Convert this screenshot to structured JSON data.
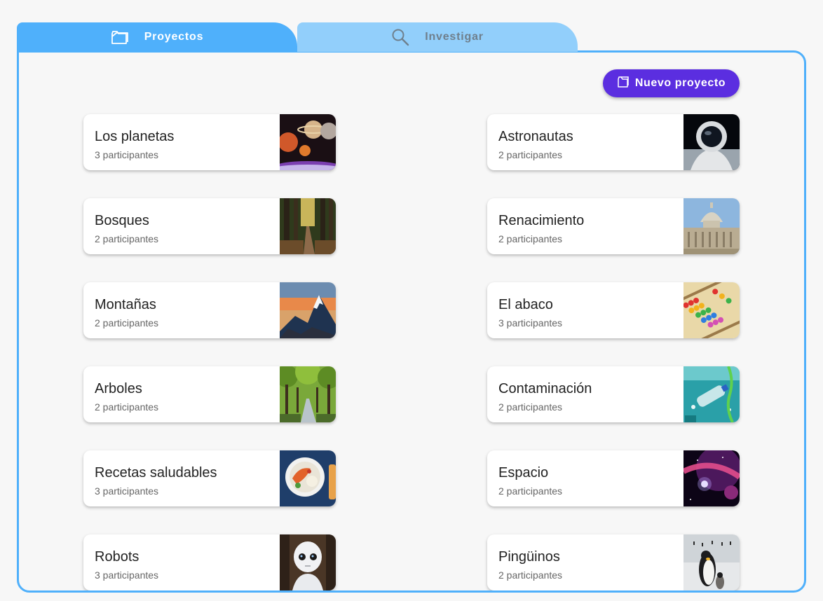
{
  "tabs": {
    "projects_label": "Proyectos",
    "research_label": "Investigar",
    "projects_icon": "folder-icon",
    "research_icon": "search-icon"
  },
  "toolbar": {
    "new_project_label": "Nuevo proyecto",
    "new_project_icon": "folder-icon"
  },
  "colors": {
    "accent": "#4fb0fb",
    "tab_inactive": "#92cffb",
    "button": "#5b2ee0"
  },
  "projects": [
    {
      "title": "Los planetas",
      "participants": "3 participantes",
      "image": "planets-image"
    },
    {
      "title": "Astronautas",
      "participants": "2 participantes",
      "image": "astronaut-image"
    },
    {
      "title": "Bosques",
      "participants": "2 participantes",
      "image": "forest-image"
    },
    {
      "title": "Renacimiento",
      "participants": "2 participantes",
      "image": "basilica-image"
    },
    {
      "title": "Montañas",
      "participants": "2 participantes",
      "image": "mountains-image"
    },
    {
      "title": "El abaco",
      "participants": "3 participantes",
      "image": "abacus-image"
    },
    {
      "title": "Arboles",
      "participants": "2 participantes",
      "image": "trees-image"
    },
    {
      "title": "Contaminación",
      "participants": "2 participantes",
      "image": "pollution-image"
    },
    {
      "title": "Recetas saludables",
      "participants": "3 participantes",
      "image": "healthy-food-image"
    },
    {
      "title": "Espacio",
      "participants": "2 participantes",
      "image": "space-image"
    },
    {
      "title": "Robots",
      "participants": "3 participantes",
      "image": "robot-image"
    },
    {
      "title": "Pingüinos",
      "participants": "2 participantes",
      "image": "penguins-image"
    }
  ]
}
